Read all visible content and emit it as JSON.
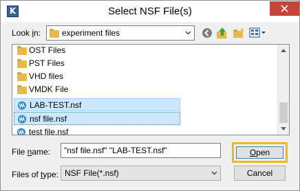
{
  "window": {
    "title": "Select NSF File(s)",
    "app_icon_letter": "K",
    "close_glyph": "close-icon"
  },
  "lookin": {
    "label_prefix": "Look ",
    "label_mnemonic": "i",
    "label_suffix": "n:",
    "value": "experiment files"
  },
  "toolbar": {
    "icons": [
      "back-icon",
      "up-folder-icon",
      "new-folder-icon",
      "views-menu-icon"
    ]
  },
  "files": [
    {
      "name": "OST Files",
      "type": "folder",
      "selected": false
    },
    {
      "name": "PST Files",
      "type": "folder",
      "selected": false
    },
    {
      "name": "VHD files",
      "type": "folder",
      "selected": false
    },
    {
      "name": "VMDK File",
      "type": "folder",
      "selected": false
    },
    {
      "name": "LAB-TEST.nsf",
      "type": "nsf",
      "selected": true
    },
    {
      "name": "nsf file.nsf",
      "type": "nsf",
      "selected": true,
      "focused": true
    },
    {
      "name": "test file.nsf",
      "type": "nsf",
      "selected": false
    }
  ],
  "filename": {
    "label_prefix": "File ",
    "label_mnemonic": "n",
    "label_suffix": "ame:",
    "value": "\"nsf file.nsf\" \"LAB-TEST.nsf\""
  },
  "filetype": {
    "label_prefix": "Files of ",
    "label_mnemonic": "t",
    "label_suffix": "ype:",
    "value": "NSF File(*.nsf)"
  },
  "buttons": {
    "open_mnemonic": "O",
    "open_rest": "pen",
    "cancel": "Cancel"
  },
  "colors": {
    "highlight_border": "#f2b912",
    "selection_bg": "#cce8ff",
    "close_bg": "#c7443b"
  }
}
